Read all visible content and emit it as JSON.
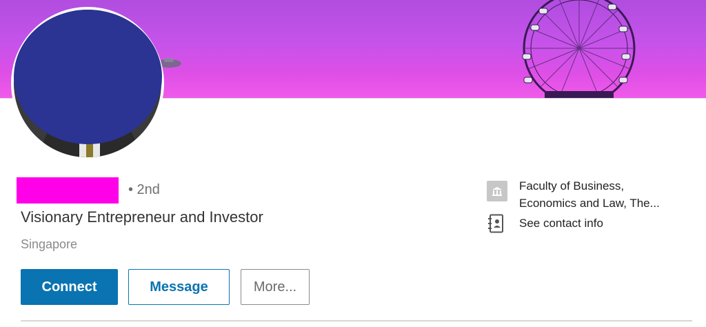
{
  "profile": {
    "degree": "• 2nd",
    "headline": "Visionary Entrepreneur and Investor",
    "location": "Singapore"
  },
  "info": {
    "education_line1": "Faculty of Business,",
    "education_line2": "Economics and Law, The...",
    "contact": "See contact info"
  },
  "actions": {
    "connect": "Connect",
    "message": "Message",
    "more": "More..."
  },
  "colors": {
    "primary": "#0a73b1",
    "redaction_name": "#ff00e9",
    "redaction_avatar": "#2b3492"
  },
  "icons": {
    "education": "school-building-icon",
    "contact": "contact-book-icon"
  }
}
